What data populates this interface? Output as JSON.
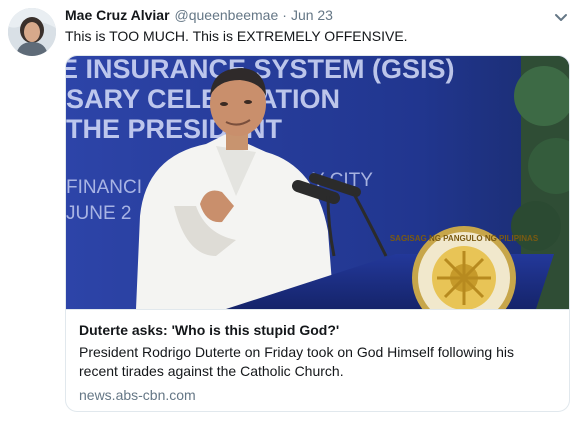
{
  "tweet": {
    "name": "Mae Cruz Alviar",
    "handle": "@queenbeemae",
    "separator": "·",
    "date": "Jun 23",
    "text": "This is TOO MUCH. This is EXTREMELY OFFENSIVE."
  },
  "card": {
    "banner_lines": [
      "E INSURANCE SYSTEM (GSIS)",
      "SARY CELEBRATION",
      "THE PRESIDENT",
      "FINANCI",
      "JUNE 2"
    ],
    "city_text": "Y CITY",
    "seal_text": "SAGISAG NG PANGULO NG PILIPINAS",
    "title": "Duterte asks: 'Who is this stupid God?'",
    "description": "President Rodrigo Duterte on Friday took on God Himself following his recent tirades against the Catholic Church.",
    "domain": "news.abs-cbn.com"
  },
  "icons": {
    "caret": "chevron-down-icon"
  },
  "colors": {
    "name": "#14171a",
    "secondary": "#657786",
    "border": "#e1e8ed",
    "banner": "#233a9c",
    "podium": "#1c2f86"
  }
}
